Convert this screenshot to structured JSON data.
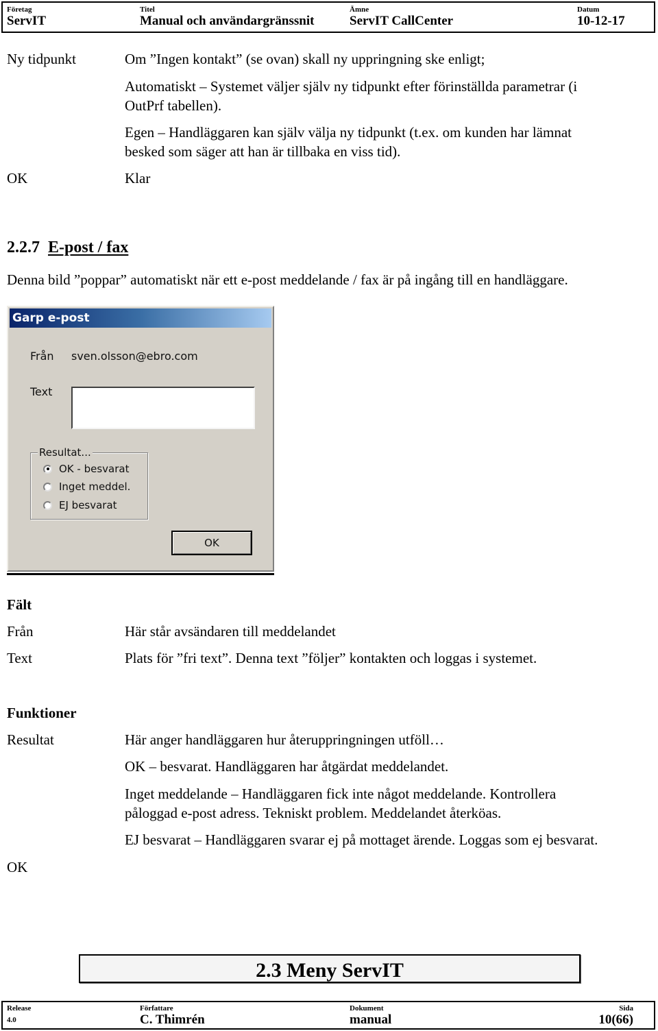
{
  "header": {
    "company_label": "Företag",
    "company": "ServIT",
    "title_label": "Titel",
    "title": "Manual och användargränssnit",
    "subject_label": "Ämne",
    "subject": "ServIT CallCenter",
    "date_label": "Datum",
    "date": "10-12-17"
  },
  "ny_tidpunkt": {
    "term": "Ny tidpunkt",
    "intro": "Om ”Ingen kontakt” (se ovan) skall ny uppringning ske enligt;",
    "auto_line1": "Automatiskt – Systemet väljer själv ny tidpunkt efter förinställda parametrar (i",
    "auto_line2": "OutPrf tabellen).",
    "egen_line1": "Egen – Handläggaren kan själv välja ny tidpunkt (t.ex. om kunden har lämnat",
    "egen_line2": "besked som säger att han är tillbaka en viss tid).",
    "ok_term": "OK",
    "ok_desc": "Klar"
  },
  "section": {
    "number": "2.2.7",
    "title": "E-post / fax",
    "intro": "Denna bild ”poppar” automatiskt när ett e-post meddelande / fax är på ingång till en handläggare."
  },
  "dialog": {
    "title": "Garp e-post",
    "from_label": "Från",
    "from_value": "sven.olsson@ebro.com",
    "text_label": "Text",
    "text_value": "",
    "group_label": "Resultat...",
    "options": [
      {
        "label": "OK - besvarat",
        "selected": true
      },
      {
        "label": "Inget meddel.",
        "selected": false
      },
      {
        "label": "EJ besvarat",
        "selected": false
      }
    ],
    "ok_label": "OK"
  },
  "fields": {
    "heading": "Fält",
    "rows": [
      {
        "term": "Från",
        "desc": "Här står avsändaren till meddelandet"
      },
      {
        "term": "Text",
        "desc": "Plats för ”fri text”. Denna text ”följer” kontakten och loggas i systemet."
      }
    ]
  },
  "functions": {
    "heading": "Funktioner",
    "result_term": "Resultat",
    "result_intro": "Här anger handläggaren hur återuppringningen utföll…",
    "ok_desc": "OK – besvarat.  Handläggaren har åtgärdat meddelandet.",
    "inget_line1": "Inget meddelande – Handläggaren fick inte något meddelande. Kontrollera",
    "inget_line2": "påloggad e-post adress. Tekniskt problem. Meddelandet återköas.",
    "ej_desc": "EJ besvarat – Handläggaren svarar ej på mottaget ärende. Loggas som ej besvarat.",
    "ok_term": "OK"
  },
  "banner": {
    "title": "2.3  Meny ServIT"
  },
  "footer": {
    "release_label": "Release",
    "release": "4.0",
    "author_label": "Författare",
    "author": "C. Thimrén",
    "document_label": "Dokument",
    "document": "manual",
    "page_label": "Sida",
    "page": "10(66)"
  }
}
